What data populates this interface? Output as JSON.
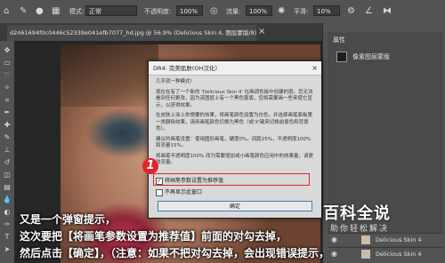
{
  "options_bar": {
    "mode_label": "模式:",
    "mode_value": "正常",
    "opacity_label": "不透明度:",
    "opacity_value": "100%",
    "flow_label": "流量:",
    "flow_value": "100%",
    "smoothing_label": "平滑:",
    "smoothing_value": "10%"
  },
  "document_tab": {
    "title": "d2461694f0c0446c52339e041efb7077_hd.jpg @ 56.9% (Delicious Skin 4, 图层蒙版/8) *",
    "close": "×"
  },
  "panels": {
    "properties_title": "属性",
    "layer_mask_label": "像素图层蒙版",
    "layer_name": "Delicious Skin 4",
    "bottom_layer_name": "Delicious Skin 4"
  },
  "dialog": {
    "title": "DR4: 完美肌肤(OH汉化)",
    "close": "×",
    "para1_title": "几乎就一种模式!",
    "para1": "现在在有了一个新的 'Delicious Skin 4' 在画调色板中创建的层。您无法看到任何更改，因为该图层上有一个黑色蒙版，您将需要画一些来使它显示，以获得效果。",
    "para2": "在皮肤上涂上你想要的效果，将画笔颜色设置为白色，并选择画笔面板第一类删除效果，请用画笔颜色切换为黑色（或'X'键来切换前景色和背景色）。",
    "para3": "建议的画笔设置：使用圆形画笔，硬度0%，间距25%，不透明度100% 和流量15%。",
    "para4": "将画笔不透明度100% 改为需要增加或小画笔颜色应用中的效果量，请更改流量。",
    "checkbox1": "将画笔参数设置为推荐值",
    "checkbox1_checked": "✓",
    "checkbox2": "不再显示此窗口",
    "ok_button": "确定"
  },
  "annotation": {
    "marker_number": "1",
    "highlight_color": "#e0242b"
  },
  "caption": {
    "line1": "又是一个弹窗提示，",
    "line2": "这次要把【将画笔参数设置为推荐值】前面的对勾去掉，",
    "line3": "然后点击【确定】，（注意：如果不把对勾去掉，会出现错误提示，"
  },
  "watermark": {
    "title": "百科全说",
    "subtitle": "助你轻松解决"
  }
}
